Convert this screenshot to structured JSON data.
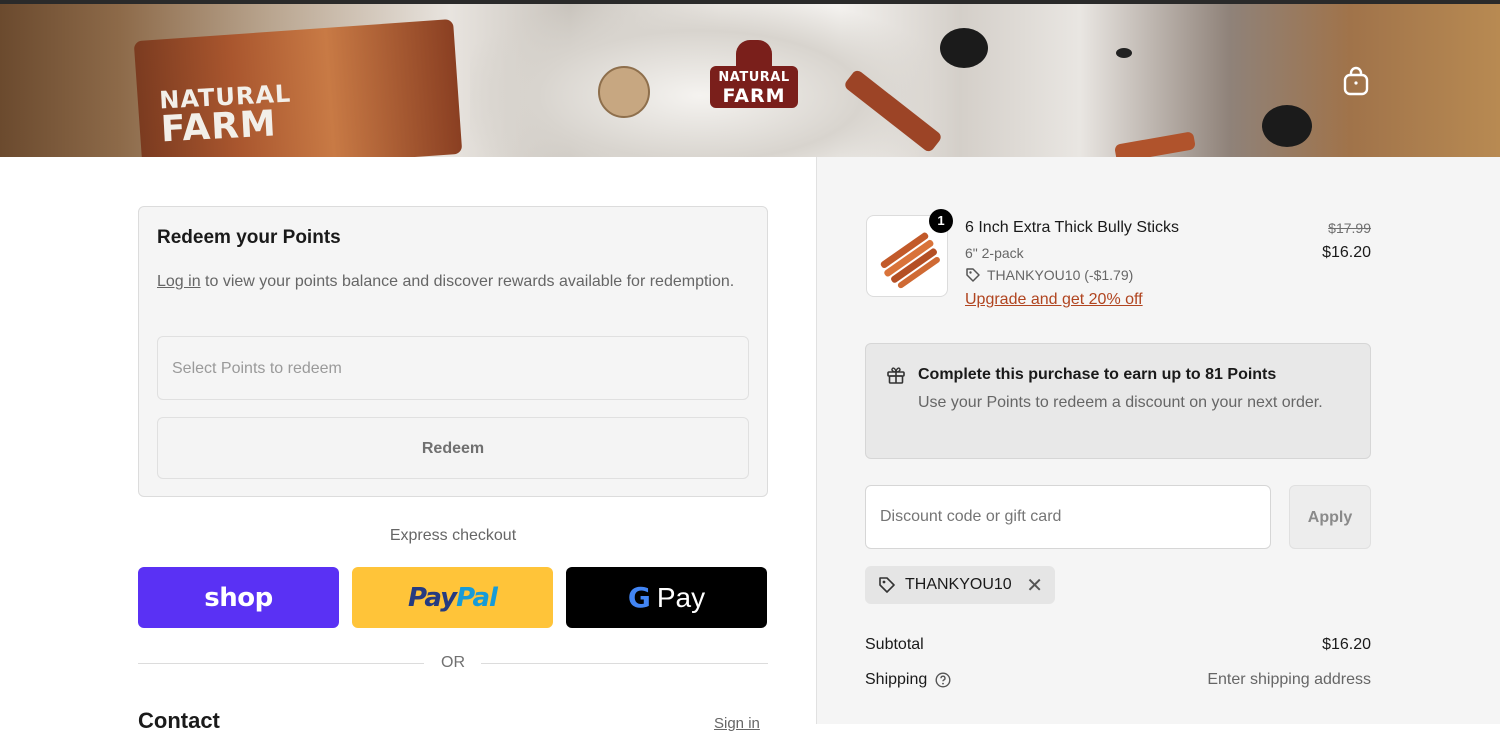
{
  "header": {
    "logo_line1": "NATURAL",
    "logo_line2": "FARM",
    "bag_line1": "NATURAL",
    "bag_line2": "FARM",
    "cart_icon": "shopping-bag-icon"
  },
  "points": {
    "title": "Redeem your Points",
    "login_link": "Log in",
    "description": " to view your points balance and discover rewards available for redemption.",
    "select_placeholder": "Select Points to redeem",
    "redeem_label": "Redeem"
  },
  "express": {
    "label": "Express checkout",
    "shop_label": "shop",
    "paypal_part1": "Pay",
    "paypal_part2": "Pal",
    "gpay_g": "G",
    "gpay_label": "Pay",
    "or_label": "OR"
  },
  "contact": {
    "title": "Contact",
    "signin_label": "Sign in"
  },
  "order": {
    "product_name": "6 Inch Extra Thick Bully Sticks",
    "variant": "6\" 2-pack",
    "discount_applied": "THANKYOU10 (-$1.79)",
    "upgrade_link": "Upgrade and get 20% off",
    "quantity": "1",
    "price_original": "$17.99",
    "price_current": "$16.20"
  },
  "earn": {
    "title": "Complete this purchase to earn up to 81 Points",
    "description": "Use your Points to redeem a discount on your next order."
  },
  "discount": {
    "placeholder": "Discount code or gift card",
    "apply_label": "Apply",
    "applied_code": "THANKYOU10"
  },
  "summary": {
    "subtotal_label": "Subtotal",
    "subtotal_value": "$16.20",
    "shipping_label": "Shipping",
    "shipping_value": "Enter shipping address"
  },
  "colors": {
    "shop_pay": "#5a31f4",
    "paypal": "#ffc439",
    "gpay": "#000000",
    "accent_link": "#b0441f",
    "logo_red": "#7a1f1b"
  }
}
